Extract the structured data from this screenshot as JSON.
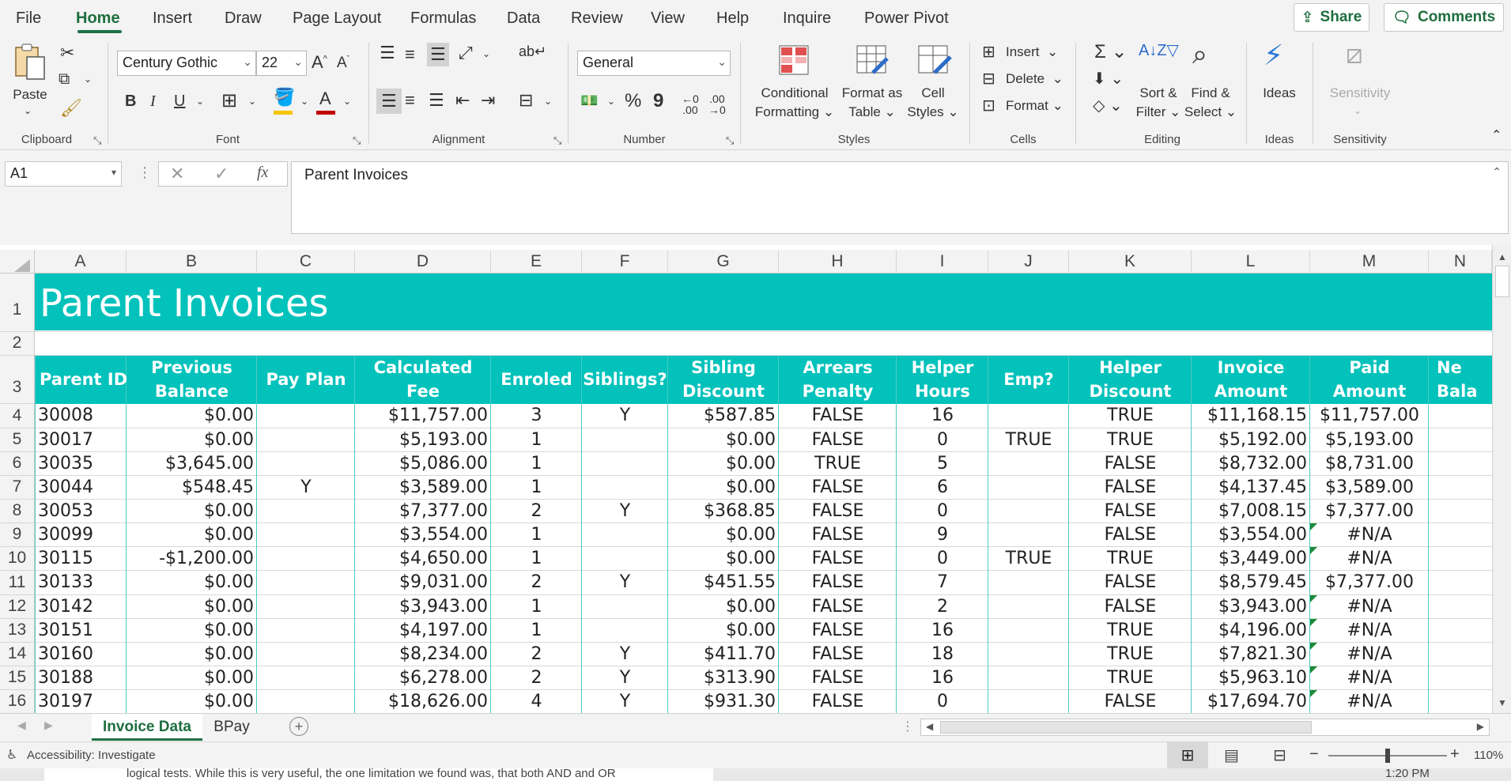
{
  "ribbon_tabs": [
    "File",
    "Home",
    "Insert",
    "Draw",
    "Page Layout",
    "Formulas",
    "Data",
    "Review",
    "View",
    "Help",
    "Inquire",
    "Power Pivot"
  ],
  "active_tab": "Home",
  "share_label": "Share",
  "comments_label": "Comments",
  "clipboard": {
    "paste": "Paste",
    "group": "Clipboard"
  },
  "font": {
    "name": "Century Gothic",
    "size": "22",
    "group": "Font",
    "bold": "B",
    "italic": "I",
    "underline": "U"
  },
  "alignment": {
    "group": "Alignment"
  },
  "number": {
    "format": "General",
    "group": "Number",
    "percent": "%",
    "comma": "9"
  },
  "styles": {
    "conditional_1": "Conditional",
    "conditional_2": "Formatting",
    "format_table_1": "Format as",
    "format_table_2": "Table",
    "cell_styles_1": "Cell",
    "cell_styles_2": "Styles",
    "group": "Styles"
  },
  "cells": {
    "insert": "Insert",
    "delete": "Delete",
    "format": "Format",
    "group": "Cells"
  },
  "editing": {
    "sort_1": "Sort &",
    "sort_2": "Filter",
    "find_1": "Find &",
    "find_2": "Select",
    "group": "Editing"
  },
  "ideas": {
    "label": "Ideas",
    "group": "Ideas"
  },
  "sensitivity": {
    "label": "Sensitivity",
    "group": "Sensitivity"
  },
  "name_box": "A1",
  "formula_value": "Parent Invoices",
  "columns": [
    "A",
    "B",
    "C",
    "D",
    "E",
    "F",
    "G",
    "H",
    "I",
    "J",
    "K",
    "L",
    "M",
    "N"
  ],
  "rows": [
    "1",
    "2",
    "3",
    "4",
    "5",
    "6",
    "7",
    "8",
    "9",
    "10",
    "11",
    "12",
    "13",
    "14",
    "15",
    "16"
  ],
  "title": "Parent Invoices",
  "headers": [
    [
      "Parent ID"
    ],
    [
      "Previous",
      "Balance"
    ],
    [
      "Pay Plan"
    ],
    [
      "Calculated",
      "Fee"
    ],
    [
      "Enroled"
    ],
    [
      "Siblings?"
    ],
    [
      "Sibling",
      "Discount"
    ],
    [
      "Arrears",
      "Penalty"
    ],
    [
      "Helper",
      "Hours"
    ],
    [
      "Emp?"
    ],
    [
      "Helper",
      "Discount"
    ],
    [
      "Invoice",
      "Amount"
    ],
    [
      "Paid",
      "Amount"
    ],
    [
      "Ne",
      "Bala"
    ]
  ],
  "table_rows": [
    [
      "30008",
      "$0.00",
      "",
      "$11,757.00",
      "3",
      "Y",
      "$587.85",
      "FALSE",
      "16",
      "",
      "TRUE",
      "$11,168.15",
      "$11,757.00"
    ],
    [
      "30017",
      "$0.00",
      "",
      "$5,193.00",
      "1",
      "",
      "$0.00",
      "FALSE",
      "0",
      "TRUE",
      "TRUE",
      "$5,192.00",
      "$5,193.00"
    ],
    [
      "30035",
      "$3,645.00",
      "",
      "$5,086.00",
      "1",
      "",
      "$0.00",
      "TRUE",
      "5",
      "",
      "FALSE",
      "$8,732.00",
      "$8,731.00"
    ],
    [
      "30044",
      "$548.45",
      "Y",
      "$3,589.00",
      "1",
      "",
      "$0.00",
      "FALSE",
      "6",
      "",
      "FALSE",
      "$4,137.45",
      "$3,589.00"
    ],
    [
      "30053",
      "$0.00",
      "",
      "$7,377.00",
      "2",
      "Y",
      "$368.85",
      "FALSE",
      "0",
      "",
      "FALSE",
      "$7,008.15",
      "$7,377.00"
    ],
    [
      "30099",
      "$0.00",
      "",
      "$3,554.00",
      "1",
      "",
      "$0.00",
      "FALSE",
      "9",
      "",
      "FALSE",
      "$3,554.00",
      "#N/A"
    ],
    [
      "30115",
      "-$1,200.00",
      "",
      "$4,650.00",
      "1",
      "",
      "$0.00",
      "FALSE",
      "0",
      "TRUE",
      "TRUE",
      "$3,449.00",
      "#N/A"
    ],
    [
      "30133",
      "$0.00",
      "",
      "$9,031.00",
      "2",
      "Y",
      "$451.55",
      "FALSE",
      "7",
      "",
      "FALSE",
      "$8,579.45",
      "$7,377.00"
    ],
    [
      "30142",
      "$0.00",
      "",
      "$3,943.00",
      "1",
      "",
      "$0.00",
      "FALSE",
      "2",
      "",
      "FALSE",
      "$3,943.00",
      "#N/A"
    ],
    [
      "30151",
      "$0.00",
      "",
      "$4,197.00",
      "1",
      "",
      "$0.00",
      "FALSE",
      "16",
      "",
      "TRUE",
      "$4,196.00",
      "#N/A"
    ],
    [
      "30160",
      "$0.00",
      "",
      "$8,234.00",
      "2",
      "Y",
      "$411.70",
      "FALSE",
      "18",
      "",
      "TRUE",
      "$7,821.30",
      "#N/A"
    ],
    [
      "30188",
      "$0.00",
      "",
      "$6,278.00",
      "2",
      "Y",
      "$313.90",
      "FALSE",
      "16",
      "",
      "TRUE",
      "$5,963.10",
      "#N/A"
    ],
    [
      "30197",
      "$0.00",
      "",
      "$18,626.00",
      "4",
      "Y",
      "$931.30",
      "FALSE",
      "0",
      "",
      "FALSE",
      "$17,694.70",
      "#N/A"
    ]
  ],
  "sheet_tabs": [
    "Invoice Data",
    "BPay"
  ],
  "active_sheet": "Invoice Data",
  "status_text": "Accessibility: Investigate",
  "zoom": "110%",
  "under_text": "logical tests. While this is very useful, the one limitation we found was, that both AND and OR",
  "under_time": "1:20 PM",
  "colors": {
    "accent": "#02c2bb",
    "excel_green": "#1e7145"
  }
}
